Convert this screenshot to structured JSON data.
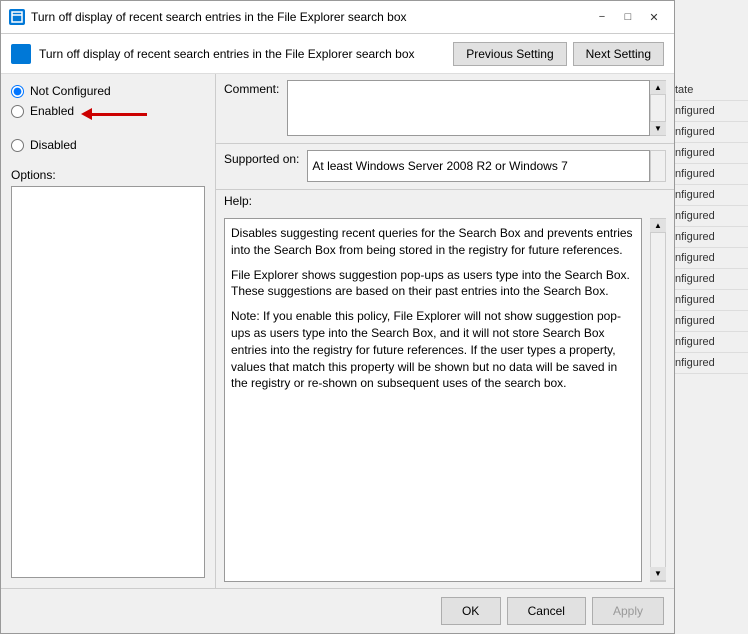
{
  "titleBar": {
    "text": "Turn off display of recent search entries in the File Explorer search box",
    "minimizeLabel": "−",
    "maximizeLabel": "□",
    "closeLabel": "✕"
  },
  "header": {
    "title": "Turn off display of recent search entries in the File Explorer search box",
    "prevButton": "Previous Setting",
    "nextButton": "Next Setting"
  },
  "radioGroup": {
    "notConfigured": "Not Configured",
    "enabled": "Enabled",
    "disabled": "Disabled"
  },
  "comment": {
    "label": "Comment:",
    "value": ""
  },
  "supportedOn": {
    "label": "Supported on:",
    "value": "At least Windows Server 2008 R2 or Windows 7"
  },
  "sections": {
    "optionsLabel": "Options:",
    "helpLabel": "Help:"
  },
  "helpText": {
    "p1": "Disables suggesting recent queries for the Search Box and prevents entries into the Search Box from being stored in the registry for future references.",
    "p2": "File Explorer shows suggestion pop-ups as users type into the Search Box.  These suggestions are based on their past entries into the Search Box.",
    "p3": "Note: If you enable this policy, File Explorer will not show suggestion pop-ups as users type into the Search Box, and it will not store Search Box entries into the registry for future references.  If the user types a property, values that match this property will be shown but no data will be saved in the registry or re-shown on subsequent uses of the search box."
  },
  "bottomButtons": {
    "ok": "OK",
    "cancel": "Cancel",
    "apply": "Apply"
  },
  "bgPanel": {
    "items": [
      "tate",
      "nfigured",
      "nfigured",
      "nfigured",
      "nfigured",
      "nfigured",
      "nfigured",
      "nfigured",
      "nfigured",
      "nfigured",
      "nfigured",
      "nfigured",
      "nfigured",
      "nfigured"
    ]
  }
}
